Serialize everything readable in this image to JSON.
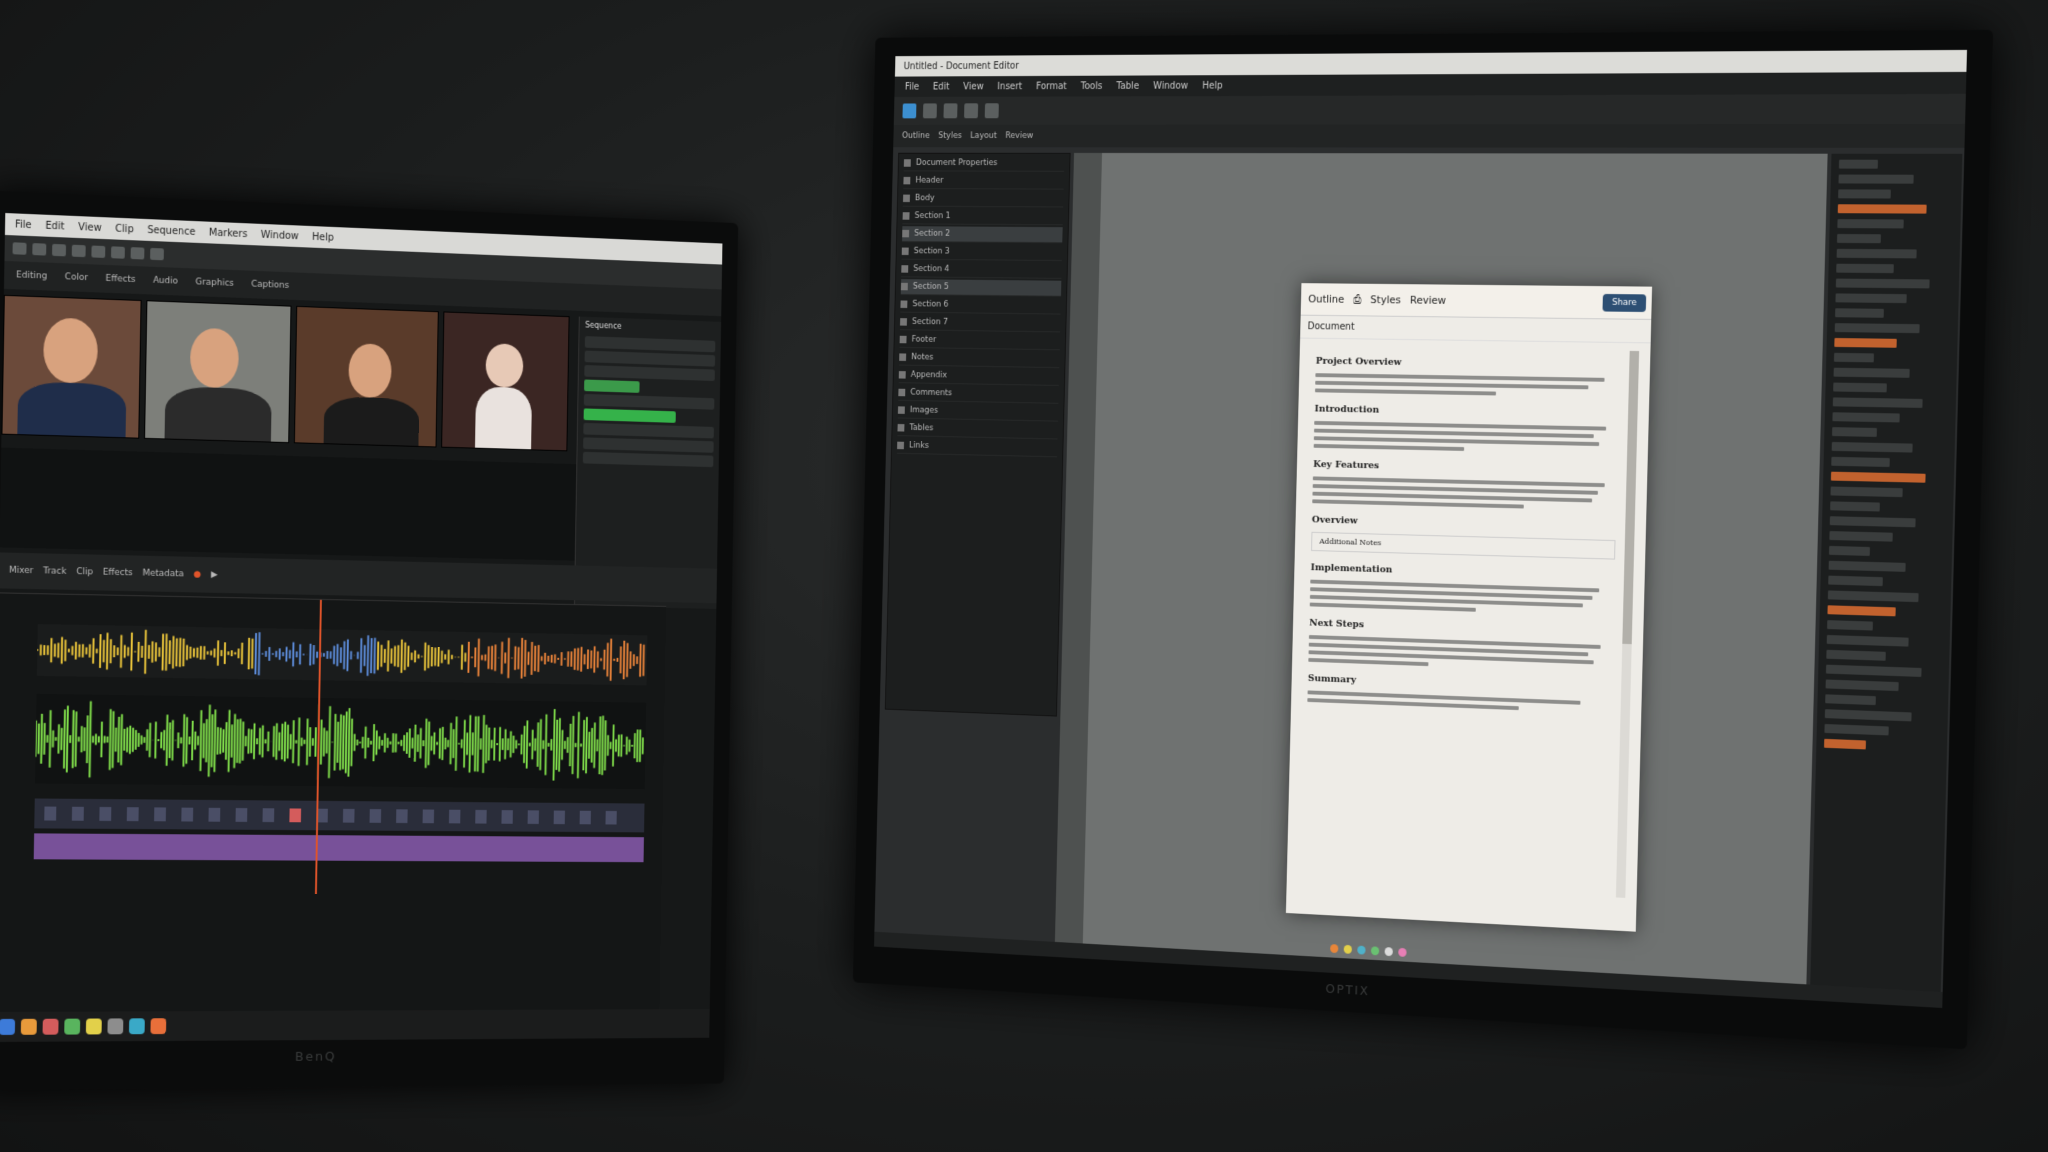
{
  "left_monitor": {
    "menu": [
      "File",
      "Edit",
      "View",
      "Clip",
      "Sequence",
      "Markers",
      "Window",
      "Help"
    ],
    "tabs": [
      "Editing",
      "Color",
      "Effects",
      "Audio",
      "Graphics",
      "Captions"
    ],
    "controls": [
      "Mixer",
      "Track",
      "Clip",
      "Effects",
      "Metadata"
    ],
    "panel_title": "Sequence",
    "brand": "BenQ",
    "colors": {
      "wave_pink": "#e77fb5",
      "wave_orange": "#e9833a",
      "wave_green": "#7fdc4a",
      "wave_yellow": "#e7c23a",
      "playhead": "#e0542a",
      "purple_track": "#8a5cb0"
    }
  },
  "right_monitor": {
    "titlebar": [
      "Untitled - Document Editor"
    ],
    "menu": [
      "File",
      "Edit",
      "View",
      "Insert",
      "Format",
      "Tools",
      "Table",
      "Window",
      "Help"
    ],
    "toolbar2": [
      "Outline",
      "Styles",
      "Layout",
      "Review"
    ],
    "layers": [
      "Document Properties",
      "Header",
      "Body",
      "Section 1",
      "Section 2",
      "Section 3",
      "Section 4",
      "Section 5",
      "Section 6",
      "Section 7",
      "Footer",
      "Notes",
      "Appendix",
      "Comments",
      "Images",
      "Tables",
      "Links"
    ],
    "doc": {
      "tab": "Outline",
      "tools": [
        "Styles",
        "Review"
      ],
      "badge": "Share",
      "crumb": "Document",
      "heading": "Project Overview",
      "sections": [
        "Introduction",
        "Key Features",
        "Overview",
        "Implementation",
        "Next Steps",
        "Summary"
      ],
      "note_box": "Additional Notes"
    },
    "brand": "OPTIX",
    "colors": {
      "canvas": "#6f7271",
      "badge": "#2d4f73",
      "page": "#eeece7"
    }
  }
}
